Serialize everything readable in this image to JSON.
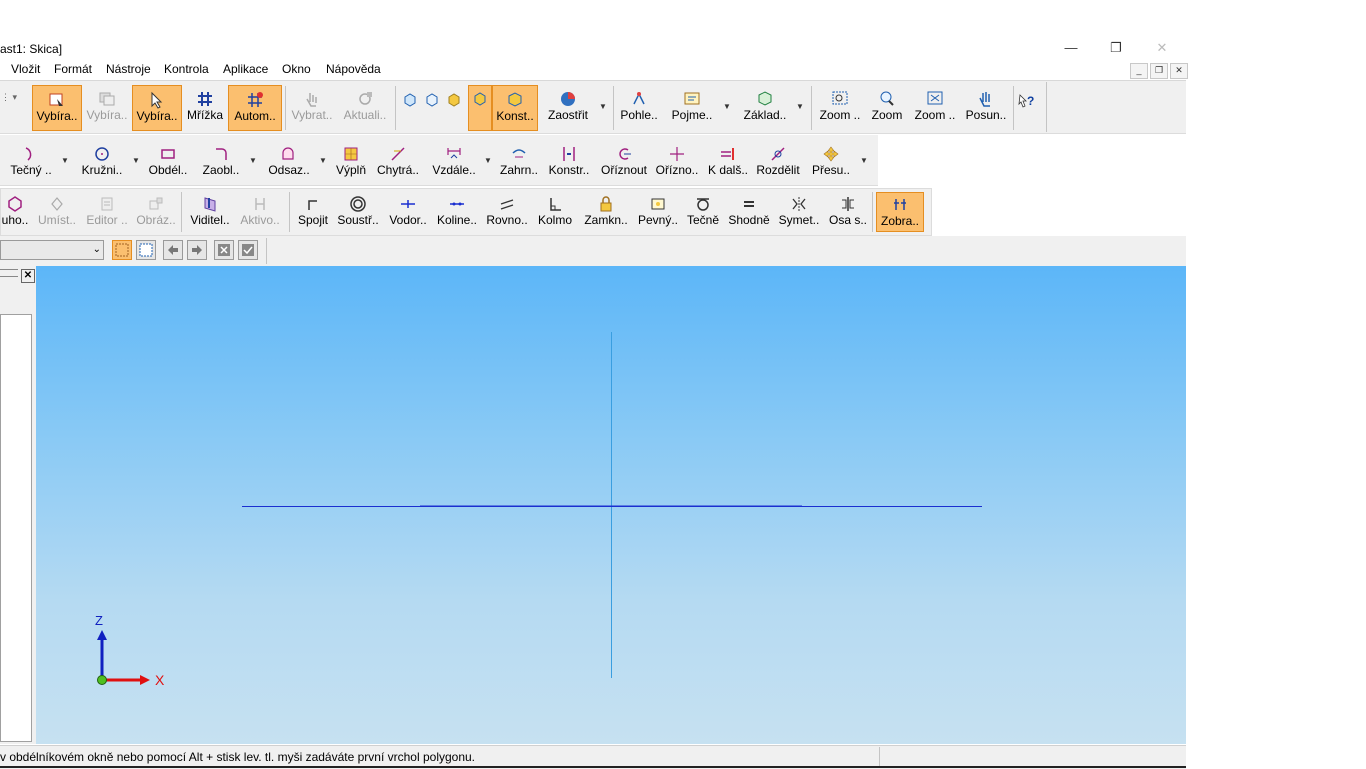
{
  "window": {
    "title": "ast1: Skica]",
    "minimize": "—",
    "restore": "❐",
    "close": "✕"
  },
  "menu": [
    "Vložit",
    "Formát",
    "Nástroje",
    "Kontrola",
    "Aplikace",
    "Okno",
    "Nápověda"
  ],
  "mdi": {
    "minimize": "_",
    "restore": "❐",
    "close": "✕"
  },
  "toolbar1": [
    {
      "label": "Vybíra..",
      "icon": "select-box-icon",
      "state": "active"
    },
    {
      "label": "Vybíra..",
      "icon": "select-copy-icon",
      "state": "disabled"
    },
    {
      "label": "Vybíra..",
      "icon": "select-pointer-icon",
      "state": "active"
    },
    {
      "label": "Mřížka",
      "icon": "grid-hash-icon",
      "state": "normal"
    },
    {
      "label": "Autom..",
      "icon": "auto-grid-icon",
      "state": "active"
    },
    {
      "label": "Vybrat..",
      "icon": "select-hand-icon",
      "state": "disabled"
    },
    {
      "label": "Aktuali..",
      "icon": "refresh-icon",
      "state": "disabled"
    },
    {
      "label": "Konst..",
      "icon": "construction-cube-icon",
      "state": "active"
    },
    {
      "label": "Zaostřit",
      "icon": "focus-sphere-icon",
      "state": "normal"
    },
    {
      "label": "Pohle..",
      "icon": "view-icon",
      "state": "normal"
    },
    {
      "label": "Pojme..",
      "icon": "named-view-icon",
      "state": "normal"
    },
    {
      "label": "Základ..",
      "icon": "base-icon",
      "state": "normal"
    },
    {
      "label": "Zoom ..",
      "icon": "zoom-area-icon",
      "state": "normal"
    },
    {
      "label": "Zoom",
      "icon": "zoom-icon",
      "state": "normal"
    },
    {
      "label": "Zoom ..",
      "icon": "zoom-fit-icon",
      "state": "normal"
    },
    {
      "label": "Posun..",
      "icon": "pan-icon",
      "state": "normal"
    }
  ],
  "toolbar2": [
    {
      "label": "Tečný ..",
      "icon": "tangent-arc-icon"
    },
    {
      "label": "Kružni..",
      "icon": "circle-icon"
    },
    {
      "label": "Obdél..",
      "icon": "rectangle-icon"
    },
    {
      "label": "Zaobl..",
      "icon": "fillet-icon"
    },
    {
      "label": "Odsaz..",
      "icon": "offset-icon"
    },
    {
      "label": "Výplň",
      "icon": "fill-icon"
    },
    {
      "label": "Chytrá..",
      "icon": "smart-dimension-icon"
    },
    {
      "label": "Vzdále..",
      "icon": "distance-icon"
    },
    {
      "label": "Zahrn..",
      "icon": "include-icon"
    },
    {
      "label": "Konstr..",
      "icon": "construction-icon"
    },
    {
      "label": "Oříznout",
      "icon": "trim-icon"
    },
    {
      "label": "Ořízno..",
      "icon": "trim-corner-icon"
    },
    {
      "label": "K dalš..",
      "icon": "extend-icon"
    },
    {
      "label": "Rozdělit",
      "icon": "split-icon"
    },
    {
      "label": "Přesu..",
      "icon": "move-icon"
    }
  ],
  "toolbar3": [
    {
      "label": "uho..",
      "icon": "polygon-icon",
      "state": "normal"
    },
    {
      "label": "Umíst..",
      "icon": "place-icon",
      "state": "disabled"
    },
    {
      "label": "Editor ..",
      "icon": "editor-icon",
      "state": "disabled"
    },
    {
      "label": "Obráz..",
      "icon": "image-icon",
      "state": "disabled"
    },
    {
      "label": "Viditel..",
      "icon": "visibility-icon",
      "state": "normal"
    },
    {
      "label": "Aktivo..",
      "icon": "activate-icon",
      "state": "disabled"
    },
    {
      "label": "Spojit",
      "icon": "connect-icon",
      "state": "normal"
    },
    {
      "label": "Soustř..",
      "icon": "concentric-icon",
      "state": "normal"
    },
    {
      "label": "Vodor..",
      "icon": "horizontal-icon",
      "state": "normal"
    },
    {
      "label": "Koline..",
      "icon": "collinear-icon",
      "state": "normal"
    },
    {
      "label": "Rovno..",
      "icon": "parallel-icon",
      "state": "normal"
    },
    {
      "label": "Kolmo",
      "icon": "perpendicular-icon",
      "state": "normal"
    },
    {
      "label": "Zamkn..",
      "icon": "lock-icon",
      "state": "normal"
    },
    {
      "label": "Pevný..",
      "icon": "rigid-icon",
      "state": "normal"
    },
    {
      "label": "Tečně",
      "icon": "tangent-icon",
      "state": "normal"
    },
    {
      "label": "Shodně",
      "icon": "equal-icon",
      "state": "normal"
    },
    {
      "label": "Symet..",
      "icon": "symmetric-icon",
      "state": "normal"
    },
    {
      "label": "Osa s..",
      "icon": "symmetry-axis-icon",
      "state": "normal"
    },
    {
      "label": "Zobra..",
      "icon": "show-relations-icon",
      "state": "active"
    }
  ],
  "triad": {
    "z": "Z",
    "x": "X"
  },
  "status": "v obdélníkovém okně nebo pomocí Alt + stisk lev. tl. myši zadáváte první vrchol polygonu.",
  "colors": {
    "active": "#fbbf6f",
    "accent": "#e58e21",
    "axis_v": "#3a9ee0",
    "axis_h": "#1a2fd0",
    "triad_z": "#1020c0",
    "triad_x": "#e01010"
  }
}
